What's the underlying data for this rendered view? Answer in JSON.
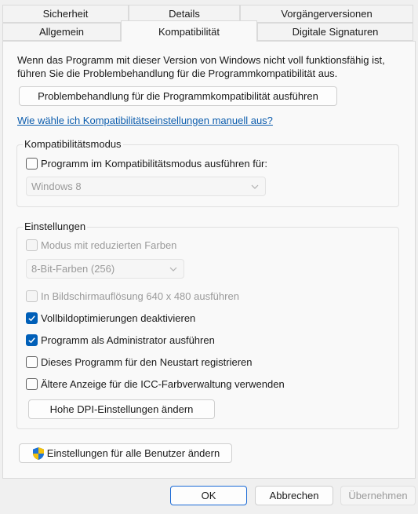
{
  "tabs": {
    "row1": [
      "Sicherheit",
      "Details",
      "Vorgängerversionen"
    ],
    "row2": [
      "Allgemein",
      "Kompatibilität",
      "Digitale Signaturen"
    ],
    "active": "Kompatibilität"
  },
  "intro": {
    "line1": "Wenn das Programm mit dieser Version von Windows nicht voll funktionsfähig ist,",
    "line2": "führen Sie die Problembehandlung für die Programmkompatibilität aus."
  },
  "troubleshoot_button": "Problembehandlung für die Programmkompatibilität ausführen",
  "manual_link": "Wie wähle ich Kompatibilitätseinstellungen manuell aus?",
  "compat_mode": {
    "title": "Kompatibilitätsmodus",
    "checkbox_label": "Programm im Kompatibilitätsmodus ausführen für:",
    "checked": false,
    "os_select": "Windows 8"
  },
  "settings": {
    "title": "Einstellungen",
    "reduced_colors": {
      "label": "Modus mit reduzierten Farben",
      "checked": false,
      "disabled": true
    },
    "color_select": "8-Bit-Farben (256)",
    "res_640": {
      "label": "In Bildschirmauflösung 640 x 480 ausführen",
      "checked": false,
      "disabled": true
    },
    "fullscreen_opt": {
      "label": "Vollbildoptimierungen deaktivieren",
      "checked": true
    },
    "run_admin": {
      "label": "Programm als Administrator ausführen",
      "checked": true
    },
    "restart_register": {
      "label": "Dieses Programm für den Neustart registrieren",
      "checked": false
    },
    "icc_legacy": {
      "label": "Ältere Anzeige für die ICC-Farbverwaltung verwenden",
      "checked": false
    },
    "dpi_button": "Hohe DPI-Einstellungen ändern"
  },
  "all_users_button": "Einstellungen für alle Benutzer ändern",
  "footer": {
    "ok": "OK",
    "cancel": "Abbrechen",
    "apply": "Übernehmen"
  },
  "colors": {
    "accent": "#005fb8",
    "link": "#0b5cad"
  },
  "icons": {
    "shield": "uac-shield-icon",
    "checkmark": "checkmark-icon",
    "chevron": "chevron-down-icon"
  }
}
